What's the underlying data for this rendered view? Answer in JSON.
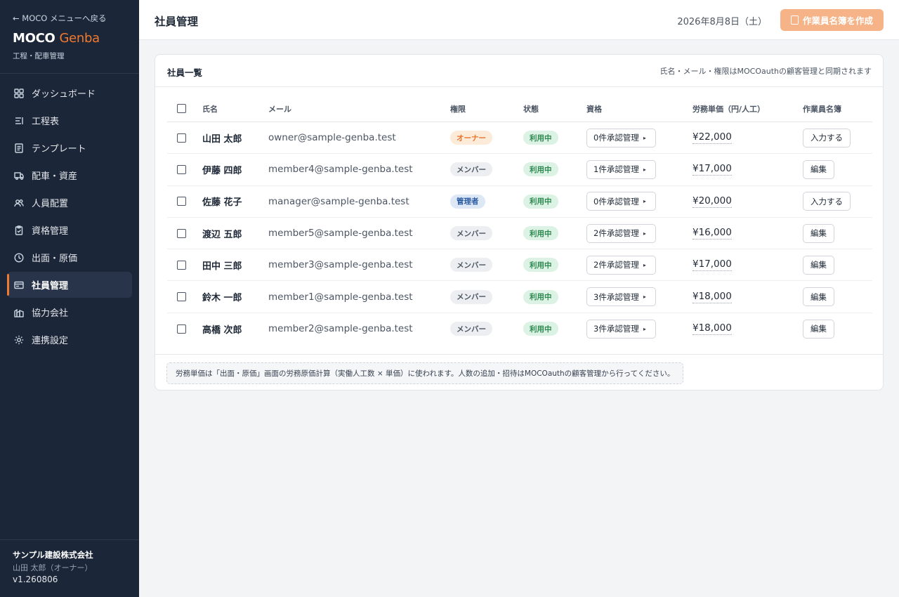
{
  "sidebar": {
    "back_link": "← MOCO メニューへ戻る",
    "logo_main": "MOCO",
    "logo_accent": "Genba",
    "logo_sub": "工程・配車管理",
    "items": [
      {
        "label": "ダッシュボード",
        "icon": "grid-icon"
      },
      {
        "label": "工程表",
        "icon": "list-icon"
      },
      {
        "label": "テンプレート",
        "icon": "document-icon"
      },
      {
        "label": "配車・資産",
        "icon": "truck-icon"
      },
      {
        "label": "人員配置",
        "icon": "users-icon"
      },
      {
        "label": "資格管理",
        "icon": "clipboard-icon"
      },
      {
        "label": "出面・原価",
        "icon": "clock-icon"
      },
      {
        "label": "社員管理",
        "icon": "id-card-icon",
        "active": true
      },
      {
        "label": "協力会社",
        "icon": "building-icon"
      },
      {
        "label": "連携設定",
        "icon": "sun-icon"
      }
    ],
    "company": "サンプル建設株式会社",
    "user": "山田 太郎（オーナー）",
    "version": "v1.260806"
  },
  "header": {
    "title": "社員管理",
    "date": "2026年8月8日（土）",
    "create_button": "作業員名簿を作成"
  },
  "card": {
    "title": "社員一覧",
    "note": "氏名・メール・権限はMOCOauthの顧客管理と同期されます",
    "columns": {
      "name": "氏名",
      "mail": "メール",
      "role": "権限",
      "status": "状態",
      "qual": "資格",
      "wage": "労務単価（円/人工）",
      "roster": "作業員名簿"
    },
    "rows": [
      {
        "name": "山田 太郎",
        "mail": "owner@sample-genba.test",
        "role": "オーナー",
        "role_kind": "owner",
        "status": "利用中",
        "qual": "0件承認管理",
        "wage": "¥22,000",
        "roster": "入力する"
      },
      {
        "name": "伊藤 四郎",
        "mail": "member4@sample-genba.test",
        "role": "メンバー",
        "role_kind": "member",
        "status": "利用中",
        "qual": "1件承認管理",
        "wage": "¥17,000",
        "roster": "編集"
      },
      {
        "name": "佐藤 花子",
        "mail": "manager@sample-genba.test",
        "role": "管理者",
        "role_kind": "manager",
        "status": "利用中",
        "qual": "0件承認管理",
        "wage": "¥20,000",
        "roster": "入力する"
      },
      {
        "name": "渡辺 五郎",
        "mail": "member5@sample-genba.test",
        "role": "メンバー",
        "role_kind": "member",
        "status": "利用中",
        "qual": "2件承認管理",
        "wage": "¥16,000",
        "roster": "編集"
      },
      {
        "name": "田中 三郎",
        "mail": "member3@sample-genba.test",
        "role": "メンバー",
        "role_kind": "member",
        "status": "利用中",
        "qual": "2件承認管理",
        "wage": "¥17,000",
        "roster": "編集"
      },
      {
        "name": "鈴木 一郎",
        "mail": "member1@sample-genba.test",
        "role": "メンバー",
        "role_kind": "member",
        "status": "利用中",
        "qual": "3件承認管理",
        "wage": "¥18,000",
        "roster": "編集"
      },
      {
        "name": "高橋 次郎",
        "mail": "member2@sample-genba.test",
        "role": "メンバー",
        "role_kind": "member",
        "status": "利用中",
        "qual": "3件承認管理",
        "wage": "¥18,000",
        "roster": "編集"
      }
    ],
    "footnote": "労務単価は「出面・原価」画面の労務原価計算（実働人工数 × 単価）に使われます。人数の追加・招待はMOCOauthの顧客管理から行ってください。"
  },
  "colors": {
    "sidebar_bg": "#1b2638",
    "accent": "#f07a2e",
    "create_button_bg": "#f5b387"
  }
}
